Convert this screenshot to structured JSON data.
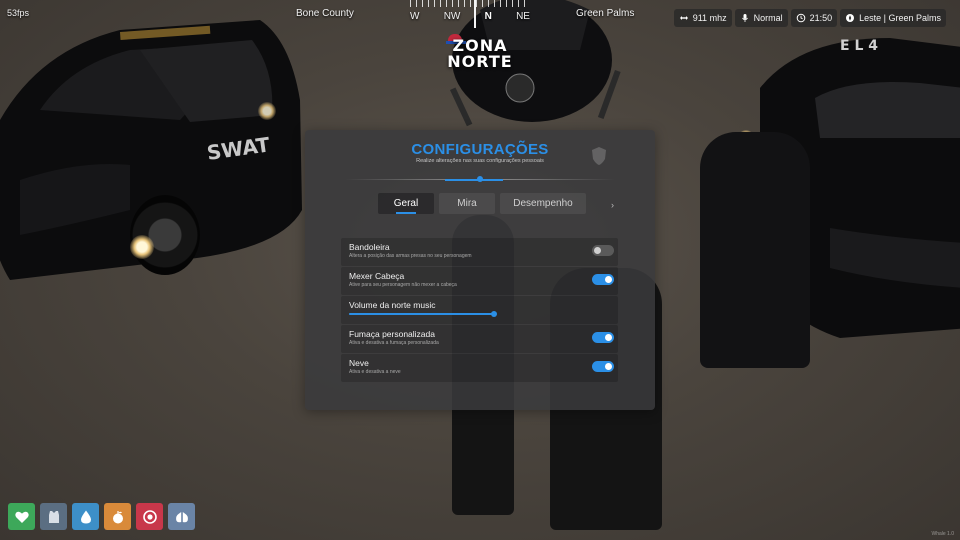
{
  "hud": {
    "fps": "53fps",
    "zone_left": "Bone County",
    "zone_right": "Green Palms",
    "compass": [
      "W",
      "NW",
      "N",
      "NE"
    ],
    "compass_active": "N",
    "status": {
      "radio": "911 mhz",
      "voice": "Normal",
      "time": "21:50",
      "location": "Leste | Green Palms"
    },
    "watermark": "Whale 1.0"
  },
  "logo": {
    "line1": "ZONA",
    "line2": "NORTE"
  },
  "scene": {
    "swat_text": "SWAT"
  },
  "panel": {
    "title": "CONFIGURAÇÕES",
    "subtitle": "Realize alterações nas suas configurações pessoais",
    "tabs": [
      {
        "label": "Geral",
        "active": true
      },
      {
        "label": "Mira",
        "active": false
      },
      {
        "label": "Desempenho",
        "active": false
      }
    ],
    "tabs_more": "›",
    "settings": {
      "bandoleira": {
        "label": "Bandoleira",
        "description": "Altera a posição das armas presas no seu personagem",
        "enabled": false
      },
      "mexer_cabeca": {
        "label": "Mexer Cabeça",
        "description": "Ative para seu personagem não mexer a cabeça",
        "enabled": true
      },
      "volume": {
        "label": "Volume da norte music",
        "value_percent": 100
      },
      "fumaca": {
        "label": "Fumaça personalizada",
        "description": "Ativa e desativa a fumaça personalizada",
        "enabled": true
      },
      "neve": {
        "label": "Neve",
        "description": "Ativa e desativa a neve",
        "enabled": true
      }
    }
  },
  "hotbar": [
    {
      "icon": "heart-icon",
      "color": "#3da85a"
    },
    {
      "icon": "armor-vest-icon",
      "color": "#5b6e82"
    },
    {
      "icon": "water-drop-icon",
      "color": "#3d8fc8"
    },
    {
      "icon": "food-icon",
      "color": "#d98a3a"
    },
    {
      "icon": "stress-icon",
      "color": "#c8374a"
    },
    {
      "icon": "lungs-icon",
      "color": "#6a84a6"
    }
  ],
  "colors": {
    "accent": "#2b8fe6",
    "panel_bg": "#3a3a3c"
  }
}
